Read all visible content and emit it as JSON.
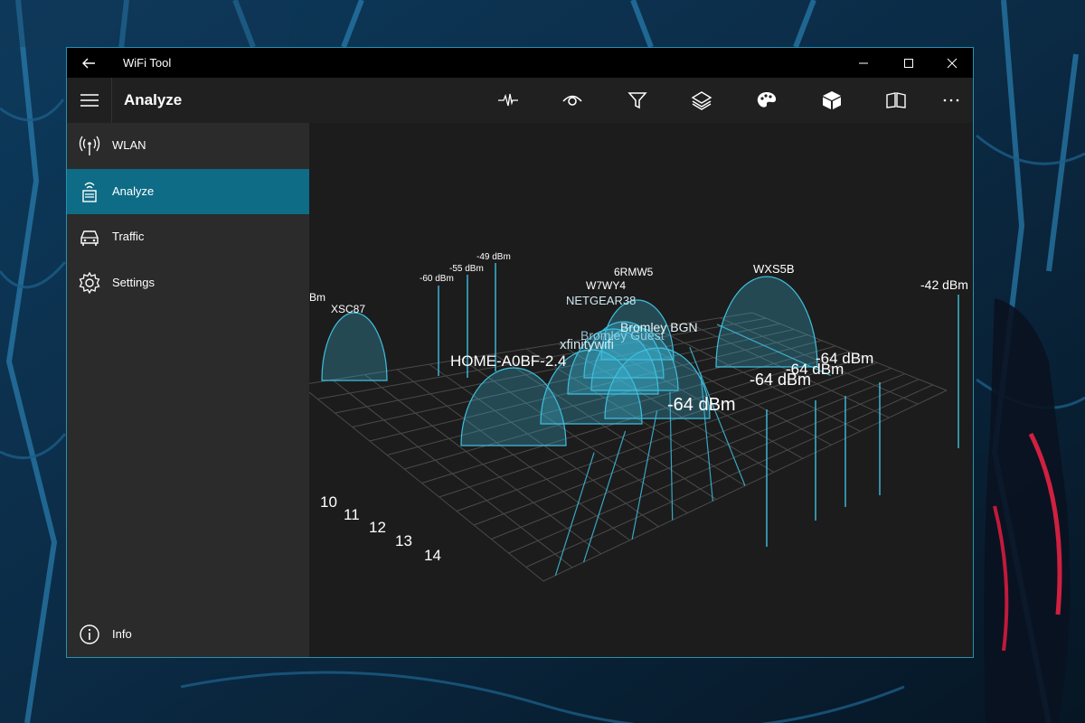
{
  "window": {
    "title": "WiFi Tool"
  },
  "appbar": {
    "page_title": "Analyze",
    "tools": [
      {
        "icon": "pulse-icon"
      },
      {
        "icon": "eye-icon"
      },
      {
        "icon": "filter-icon"
      },
      {
        "icon": "layers-icon"
      },
      {
        "icon": "palette-icon"
      },
      {
        "icon": "cube-icon"
      },
      {
        "icon": "book-icon"
      },
      {
        "icon": "more-icon"
      }
    ]
  },
  "sidebar": {
    "items": [
      {
        "label": "WLAN",
        "icon": "antenna-icon"
      },
      {
        "label": "Analyze",
        "icon": "router-icon",
        "active": true
      },
      {
        "label": "Traffic",
        "icon": "car-icon"
      },
      {
        "label": "Settings",
        "icon": "gear-icon"
      }
    ],
    "footer": {
      "label": "Info",
      "icon": "info-icon"
    }
  },
  "colors": {
    "accent": "#0e6c86",
    "grid": "#4a4a4a",
    "signal": "#3ec0e0",
    "background": "#1c1c1c"
  },
  "chart_data": {
    "type": "3d-channel-graph",
    "channel_labels": [
      "10",
      "11",
      "12",
      "13",
      "14"
    ],
    "networks": [
      {
        "name": "XSC87"
      },
      {
        "name": "6RMW5"
      },
      {
        "name": "W7WY4"
      },
      {
        "name": "NETGEAR38"
      },
      {
        "name": "WXS5B"
      },
      {
        "name": "Bromley BGN"
      },
      {
        "name": "Bromley Guest"
      },
      {
        "name": "xfinitywifi"
      },
      {
        "name": "HOME-A0BF-2.4"
      }
    ],
    "signal_labels": [
      {
        "text": "Bm"
      },
      {
        "text": "-60 dBm"
      },
      {
        "text": "-55 dBm"
      },
      {
        "text": "-49 dBm"
      },
      {
        "text": "-42 dBm"
      },
      {
        "text": "-64 dBm"
      },
      {
        "text": "-64 dBm"
      },
      {
        "text": "-64 dBm"
      },
      {
        "text": "-64 dBm"
      }
    ]
  }
}
